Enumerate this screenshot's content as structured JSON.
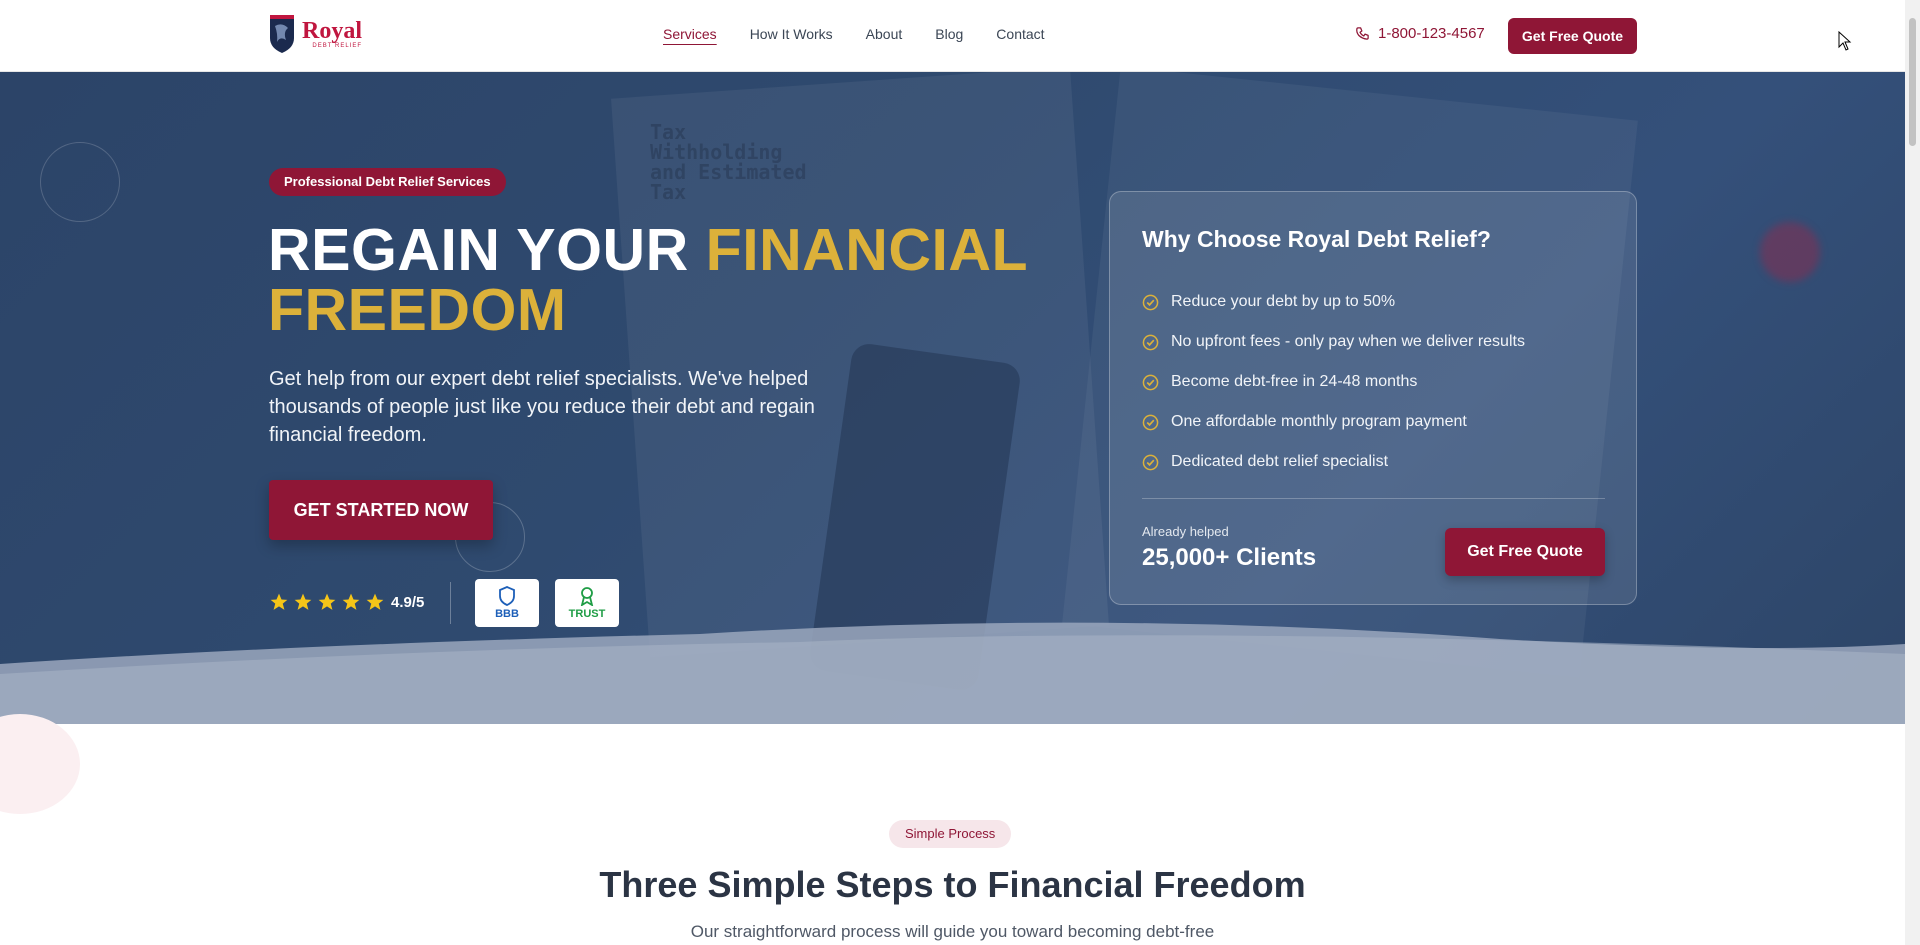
{
  "header": {
    "logo_text": "Royal",
    "logo_sub": "DEBT RELIEF",
    "nav": [
      {
        "label": "Services"
      },
      {
        "label": "How It Works"
      },
      {
        "label": "About"
      },
      {
        "label": "Blog"
      },
      {
        "label": "Contact"
      }
    ],
    "active_nav": "Services",
    "phone": "1-800-123-4567",
    "cta_label": "Get Free Quote"
  },
  "hero": {
    "badge": "Professional Debt Relief Services",
    "headline_white": "REGAIN YOUR",
    "headline_gold_1": "FINANCIAL",
    "headline_gold_2": "FREEDOM",
    "description": "Get help from our expert debt relief specialists. We've helped thousands of people just like you reduce their debt and regain financial freedom.",
    "cta_label": "GET STARTED NOW",
    "rating_value": "4.9/5",
    "star_count": 5,
    "trust_badges": [
      {
        "label": "BBB",
        "icon": "shield-icon",
        "color": "#1d5fb8"
      },
      {
        "label": "TRUST",
        "icon": "award-icon",
        "color": "#1f9d45"
      }
    ],
    "background_text": "Tax\nWithholding\nand Estimated\nTax"
  },
  "card": {
    "title": "Why Choose Royal Debt Relief?",
    "benefits": [
      "Reduce your debt by up to 50%",
      "No upfront fees - only pay when we deliver results",
      "Become debt-free in 24-48 months",
      "One affordable monthly program payment",
      "Dedicated debt relief specialist"
    ],
    "helped_label": "Already helped",
    "helped_value": "25,000+ Clients",
    "cta_label": "Get Free Quote"
  },
  "process": {
    "badge": "Simple Process",
    "title": "Three Simple Steps to Financial Freedom",
    "subtitle": "Our straightforward process will guide you toward becoming debt-free"
  },
  "colors": {
    "brand": "#8f1636",
    "gold": "#dcb13a",
    "hero_bg": "#2f4a6f"
  }
}
